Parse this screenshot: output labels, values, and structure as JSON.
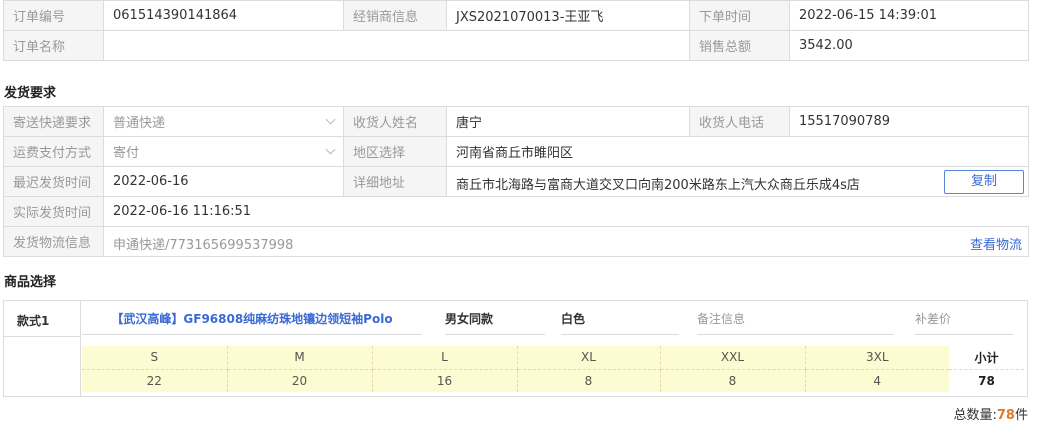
{
  "order": {
    "id_label": "订单编号",
    "id_value": "061514390141864",
    "dealer_label": "经销商信息",
    "dealer_value": "JXS2021070013-王亚飞",
    "time_label": "下单时间",
    "time_value": "2022-06-15 14:39:01",
    "name_label": "订单名称",
    "name_value": "",
    "sales_label": "销售总额",
    "sales_value": "3542.00"
  },
  "shipping": {
    "title": "发货要求",
    "express_label": "寄送快递要求",
    "express_value": "普通快递",
    "receiver_label": "收货人姓名",
    "receiver_value": "唐宁",
    "phone_label": "收货人电话",
    "phone_value": "15517090789",
    "payment_label": "运费支付方式",
    "payment_value": "寄付",
    "region_label": "地区选择",
    "region_value": "河南省商丘市睢阳区",
    "latest_label": "最迟发货时间",
    "latest_value": "2022-06-16",
    "address_label": "详细地址",
    "address_value": "商丘市北海路与富商大道交叉口向南200米路东上汽大众商丘乐成4s店",
    "copy_label": "复制",
    "actual_label": "实际发货时间",
    "actual_value": "2022-06-16 11:16:51",
    "logistics_label": "发货物流信息",
    "logistics_value": "申通快递/773165699537998",
    "view_logistics_label": "查看物流"
  },
  "products": {
    "title": "商品选择",
    "style_label": "款式1",
    "name": "【武汉高峰】GF96808纯麻纺珠地镶边领短袖Polo",
    "gender": "男女同款",
    "color": "白色",
    "remark_placeholder": "备注信息",
    "extra_price_placeholder": "补差价",
    "sizes": [
      "S",
      "M",
      "L",
      "XL",
      "XXL",
      "3XL"
    ],
    "quantities": [
      "22",
      "20",
      "16",
      "8",
      "8",
      "4"
    ],
    "subtotal_label": "小计",
    "subtotal_value": "78"
  },
  "total": {
    "label": "总数量:",
    "value": "78",
    "unit": "件"
  }
}
